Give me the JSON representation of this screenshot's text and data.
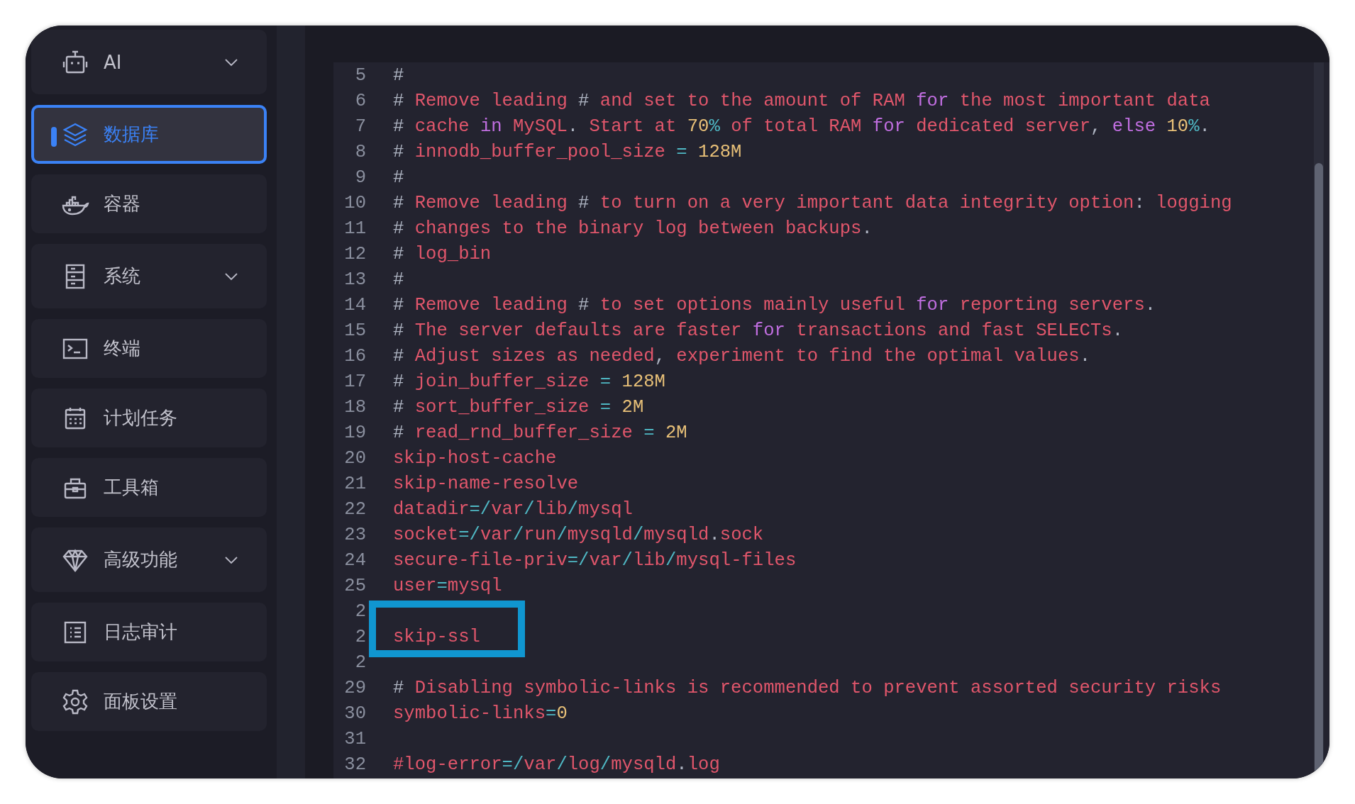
{
  "sidebar": {
    "items": [
      {
        "label": "AI",
        "kind": "robot",
        "expandable": true,
        "selected": false
      },
      {
        "label": "数据库",
        "kind": "layers",
        "expandable": false,
        "selected": true
      },
      {
        "label": "容器",
        "kind": "whale",
        "expandable": false,
        "selected": false
      },
      {
        "label": "系统",
        "kind": "cabinet",
        "expandable": true,
        "selected": false
      },
      {
        "label": "终端",
        "kind": "terminal",
        "expandable": false,
        "selected": false
      },
      {
        "label": "计划任务",
        "kind": "calendar",
        "expandable": false,
        "selected": false
      },
      {
        "label": "工具箱",
        "kind": "toolbox",
        "expandable": false,
        "selected": false
      },
      {
        "label": "高级功能",
        "kind": "diamond",
        "expandable": true,
        "selected": false
      },
      {
        "label": "日志审计",
        "kind": "list",
        "expandable": false,
        "selected": false
      },
      {
        "label": "面板设置",
        "kind": "gear",
        "expandable": false,
        "selected": false
      }
    ]
  },
  "editor": {
    "lines": [
      {
        "number": "5",
        "tokens": [
          {
            "kind": "punct",
            "text": "#"
          }
        ]
      },
      {
        "number": "6",
        "tokens": [
          {
            "kind": "punct",
            "text": "#"
          },
          {
            "kind": "text",
            "text": " Remove leading "
          },
          {
            "kind": "punct",
            "text": "#"
          },
          {
            "kind": "text",
            "text": " and set to the amount of RAM "
          },
          {
            "kind": "keyword",
            "text": "for"
          },
          {
            "kind": "text",
            "text": " the most important data"
          }
        ]
      },
      {
        "number": "7",
        "tokens": [
          {
            "kind": "punct",
            "text": "#"
          },
          {
            "kind": "text",
            "text": " cache "
          },
          {
            "kind": "keyword",
            "text": "in"
          },
          {
            "kind": "text",
            "text": " MySQL"
          },
          {
            "kind": "punct",
            "text": "."
          },
          {
            "kind": "text",
            "text": " Start at "
          },
          {
            "kind": "number",
            "text": "70"
          },
          {
            "kind": "operator",
            "text": "%"
          },
          {
            "kind": "text",
            "text": " of total RAM "
          },
          {
            "kind": "keyword",
            "text": "for"
          },
          {
            "kind": "text",
            "text": " dedicated server"
          },
          {
            "kind": "punct",
            "text": ", "
          },
          {
            "kind": "keyword",
            "text": "else "
          },
          {
            "kind": "number",
            "text": "10"
          },
          {
            "kind": "operator",
            "text": "%"
          },
          {
            "kind": "punct",
            "text": "."
          }
        ]
      },
      {
        "number": "8",
        "tokens": [
          {
            "kind": "punct",
            "text": "#"
          },
          {
            "kind": "text",
            "text": " innodb_buffer_pool_size "
          },
          {
            "kind": "operator",
            "text": "="
          },
          {
            "kind": "number",
            "text": " 128M"
          }
        ]
      },
      {
        "number": "9",
        "tokens": [
          {
            "kind": "punct",
            "text": "#"
          }
        ]
      },
      {
        "number": "10",
        "tokens": [
          {
            "kind": "punct",
            "text": "#"
          },
          {
            "kind": "text",
            "text": " Remove leading "
          },
          {
            "kind": "punct",
            "text": "#"
          },
          {
            "kind": "text",
            "text": " to turn on a very important data integrity option"
          },
          {
            "kind": "punct",
            "text": ":"
          },
          {
            "kind": "text",
            "text": " logging"
          }
        ]
      },
      {
        "number": "11",
        "tokens": [
          {
            "kind": "punct",
            "text": "#"
          },
          {
            "kind": "text",
            "text": " changes to the binary log between backups"
          },
          {
            "kind": "punct",
            "text": "."
          }
        ]
      },
      {
        "number": "12",
        "tokens": [
          {
            "kind": "punct",
            "text": "#"
          },
          {
            "kind": "text",
            "text": " log_bin"
          }
        ]
      },
      {
        "number": "13",
        "tokens": [
          {
            "kind": "punct",
            "text": "#"
          }
        ]
      },
      {
        "number": "14",
        "tokens": [
          {
            "kind": "punct",
            "text": "#"
          },
          {
            "kind": "text",
            "text": " Remove leading "
          },
          {
            "kind": "punct",
            "text": "#"
          },
          {
            "kind": "text",
            "text": " to set options mainly useful "
          },
          {
            "kind": "keyword",
            "text": "for"
          },
          {
            "kind": "text",
            "text": " reporting servers"
          },
          {
            "kind": "punct",
            "text": "."
          }
        ]
      },
      {
        "number": "15",
        "tokens": [
          {
            "kind": "punct",
            "text": "#"
          },
          {
            "kind": "text",
            "text": " The server defaults are faster "
          },
          {
            "kind": "keyword",
            "text": "for"
          },
          {
            "kind": "text",
            "text": " transactions and fast SELECTs"
          },
          {
            "kind": "punct",
            "text": "."
          }
        ]
      },
      {
        "number": "16",
        "tokens": [
          {
            "kind": "punct",
            "text": "#"
          },
          {
            "kind": "text",
            "text": " Adjust sizes as needed"
          },
          {
            "kind": "punct",
            "text": ","
          },
          {
            "kind": "text",
            "text": " experiment to find the optimal values"
          },
          {
            "kind": "punct",
            "text": "."
          }
        ]
      },
      {
        "number": "17",
        "tokens": [
          {
            "kind": "punct",
            "text": "#"
          },
          {
            "kind": "text",
            "text": " join_buffer_size "
          },
          {
            "kind": "operator",
            "text": "="
          },
          {
            "kind": "number",
            "text": " 128M"
          }
        ]
      },
      {
        "number": "18",
        "tokens": [
          {
            "kind": "punct",
            "text": "#"
          },
          {
            "kind": "text",
            "text": " sort_buffer_size "
          },
          {
            "kind": "operator",
            "text": "="
          },
          {
            "kind": "number",
            "text": " 2M"
          }
        ]
      },
      {
        "number": "19",
        "tokens": [
          {
            "kind": "punct",
            "text": "#"
          },
          {
            "kind": "text",
            "text": " read_rnd_buffer_size "
          },
          {
            "kind": "operator",
            "text": "="
          },
          {
            "kind": "number",
            "text": " 2M"
          }
        ]
      },
      {
        "number": "20",
        "tokens": [
          {
            "kind": "text",
            "text": "skip-host-cache"
          }
        ]
      },
      {
        "number": "21",
        "tokens": [
          {
            "kind": "text",
            "text": "skip-name-resolve"
          }
        ]
      },
      {
        "number": "22",
        "tokens": [
          {
            "kind": "text",
            "text": "datadir"
          },
          {
            "kind": "operator",
            "text": "=/"
          },
          {
            "kind": "text",
            "text": "var"
          },
          {
            "kind": "operator",
            "text": "/"
          },
          {
            "kind": "text",
            "text": "lib"
          },
          {
            "kind": "operator",
            "text": "/"
          },
          {
            "kind": "text",
            "text": "mysql"
          }
        ]
      },
      {
        "number": "23",
        "tokens": [
          {
            "kind": "text",
            "text": "socket"
          },
          {
            "kind": "operator",
            "text": "=/"
          },
          {
            "kind": "text",
            "text": "var"
          },
          {
            "kind": "operator",
            "text": "/"
          },
          {
            "kind": "text",
            "text": "run"
          },
          {
            "kind": "operator",
            "text": "/"
          },
          {
            "kind": "text",
            "text": "mysqld"
          },
          {
            "kind": "operator",
            "text": "/"
          },
          {
            "kind": "text",
            "text": "mysqld"
          },
          {
            "kind": "punct",
            "text": "."
          },
          {
            "kind": "text",
            "text": "sock"
          }
        ]
      },
      {
        "number": "24",
        "tokens": [
          {
            "kind": "text",
            "text": "secure-file-priv"
          },
          {
            "kind": "operator",
            "text": "=/"
          },
          {
            "kind": "text",
            "text": "var"
          },
          {
            "kind": "operator",
            "text": "/"
          },
          {
            "kind": "text",
            "text": "lib"
          },
          {
            "kind": "operator",
            "text": "/"
          },
          {
            "kind": "text",
            "text": "mysql-files"
          }
        ]
      },
      {
        "number": "25",
        "tokens": [
          {
            "kind": "text",
            "text": "user"
          },
          {
            "kind": "operator",
            "text": "="
          },
          {
            "kind": "text",
            "text": "mysql"
          }
        ]
      },
      {
        "number": "2"
      },
      {
        "number": "2",
        "highlighted": true,
        "tokens": [
          {
            "kind": "text",
            "text": "skip-ssl"
          }
        ]
      },
      {
        "number": "2"
      },
      {
        "number": "29",
        "tokens": [
          {
            "kind": "punct",
            "text": "#"
          },
          {
            "kind": "text",
            "text": " Disabling symbolic-links is recommended to prevent assorted security risks"
          }
        ]
      },
      {
        "number": "30",
        "tokens": [
          {
            "kind": "text",
            "text": "symbolic-links"
          },
          {
            "kind": "operator",
            "text": "="
          },
          {
            "kind": "number",
            "text": "0"
          }
        ]
      },
      {
        "number": "31"
      },
      {
        "number": "32",
        "tokens": [
          {
            "kind": "text",
            "text": "#log-error"
          },
          {
            "kind": "operator",
            "text": "=/"
          },
          {
            "kind": "text",
            "text": "var"
          },
          {
            "kind": "operator",
            "text": "/"
          },
          {
            "kind": "text",
            "text": "log"
          },
          {
            "kind": "operator",
            "text": "/"
          },
          {
            "kind": "text",
            "text": "mysqld"
          },
          {
            "kind": "punct",
            "text": "."
          },
          {
            "kind": "text",
            "text": "log"
          }
        ]
      }
    ]
  }
}
